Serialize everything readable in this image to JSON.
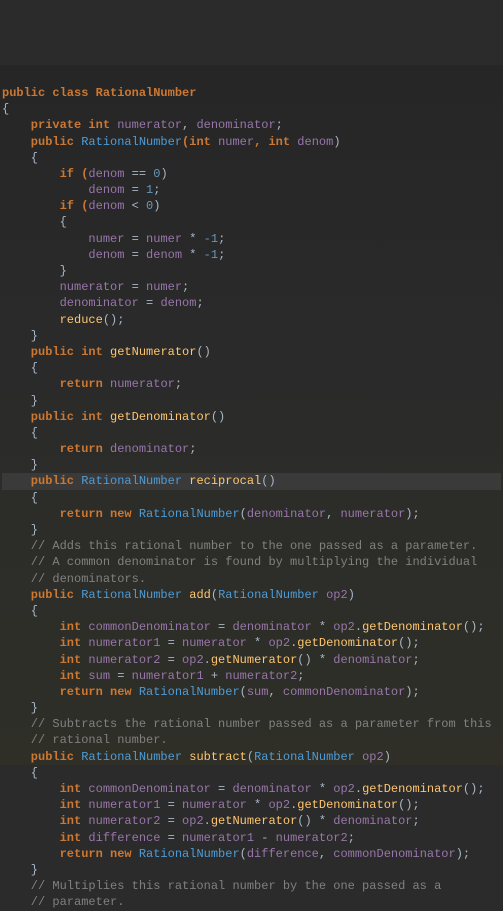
{
  "code": {
    "l00": "public class RationalNumber",
    "l01": "{",
    "l02a": "    private int ",
    "l02b": "numerator",
    "l02c": ", ",
    "l02d": "denominator",
    "l02e": ";",
    "l03a": "    public ",
    "l03b": "RationalNumber",
    "l03c": "(int ",
    "l03d": "numer",
    "l03e": ", int ",
    "l03f": "denom",
    "l03g": ")",
    "l04": "    {",
    "l05a": "        if (",
    "l05b": "denom",
    "l05c": " == ",
    "l05d": "0",
    "l05e": ")",
    "l06a": "            ",
    "l06b": "denom",
    "l06c": " = ",
    "l06d": "1",
    "l06e": ";",
    "l07a": "        if (",
    "l07b": "denom",
    "l07c": " < ",
    "l07d": "0",
    "l07e": ")",
    "l08": "        {",
    "l09a": "            ",
    "l09b": "numer",
    "l09c": " = ",
    "l09d": "numer",
    "l09e": " * ",
    "l09f": "-1",
    "l09g": ";",
    "l10a": "            ",
    "l10b": "denom",
    "l10c": " = ",
    "l10d": "denom",
    "l10e": " * ",
    "l10f": "-1",
    "l10g": ";",
    "l11": "        }",
    "l12a": "        ",
    "l12b": "numerator",
    "l12c": " = ",
    "l12d": "numer",
    "l12e": ";",
    "l13a": "        ",
    "l13b": "denominator",
    "l13c": " = ",
    "l13d": "denom",
    "l13e": ";",
    "l14a": "        ",
    "l14b": "reduce",
    "l14c": "();",
    "l15": "    }",
    "l16a": "    public int ",
    "l16b": "getNumerator",
    "l16c": "()",
    "l17": "    {",
    "l18a": "        return ",
    "l18b": "numerator",
    "l18c": ";",
    "l19": "    }",
    "l20a": "    public int ",
    "l20b": "getDenominator",
    "l20c": "()",
    "l21": "    {",
    "l22a": "        return ",
    "l22b": "denominator",
    "l22c": ";",
    "l23": "    }",
    "l24a": "    public ",
    "l24b": "RationalNumber",
    "l24c": " ",
    "l24d": "reciprocal",
    "l24e": "()",
    "l25": "    {",
    "l26a": "        return new ",
    "l26b": "RationalNumber",
    "l26c": "(",
    "l26d": "denominator",
    "l26e": ", ",
    "l26f": "numerator",
    "l26g": ");",
    "l27": "    }",
    "l28": "    // Adds this rational number to the one passed as a parameter.",
    "l29": "    // A common denominator is found by multiplying the individual",
    "l30": "    // denominators.",
    "l31a": "    public ",
    "l31b": "RationalNumber",
    "l31c": " ",
    "l31d": "add",
    "l31e": "(",
    "l31f": "RationalNumber",
    "l31g": " ",
    "l31h": "op2",
    "l31i": ")",
    "l32": "    {",
    "l33a": "        int ",
    "l33b": "commonDenominator",
    "l33c": " = ",
    "l33d": "denominator",
    "l33e": " * ",
    "l33f": "op2",
    "l33g": ".",
    "l33h": "getDenominator",
    "l33i": "();",
    "l34a": "        int ",
    "l34b": "numerator1",
    "l34c": " = ",
    "l34d": "numerator",
    "l34e": " * ",
    "l34f": "op2",
    "l34g": ".",
    "l34h": "getDenominator",
    "l34i": "();",
    "l35a": "        int ",
    "l35b": "numerator2",
    "l35c": " = ",
    "l35d": "op2",
    "l35e": ".",
    "l35f": "getNumerator",
    "l35g": "() * ",
    "l35h": "denominator",
    "l35i": ";",
    "l36a": "        int ",
    "l36b": "sum",
    "l36c": " = ",
    "l36d": "numerator1",
    "l36e": " + ",
    "l36f": "numerator2",
    "l36g": ";",
    "l37a": "        return new ",
    "l37b": "RationalNumber",
    "l37c": "(",
    "l37d": "sum",
    "l37e": ", ",
    "l37f": "commonDenominator",
    "l37g": ");",
    "l38": "    }",
    "l39": "    // Subtracts the rational number passed as a parameter from this",
    "l40": "    // rational number.",
    "l41a": "    public ",
    "l41b": "RationalNumber",
    "l41c": " ",
    "l41d": "subtract",
    "l41e": "(",
    "l41f": "RationalNumber",
    "l41g": " ",
    "l41h": "op2",
    "l41i": ")",
    "l42": "    {",
    "l43a": "        int ",
    "l43b": "commonDenominator",
    "l43c": " = ",
    "l43d": "denominator",
    "l43e": " * ",
    "l43f": "op2",
    "l43g": ".",
    "l43h": "getDenominator",
    "l43i": "();",
    "l44a": "        int ",
    "l44b": "numerator1",
    "l44c": " = ",
    "l44d": "numerator",
    "l44e": " * ",
    "l44f": "op2",
    "l44g": ".",
    "l44h": "getDenominator",
    "l44i": "();",
    "l45a": "        int ",
    "l45b": "numerator2",
    "l45c": " = ",
    "l45d": "op2",
    "l45e": ".",
    "l45f": "getNumerator",
    "l45g": "() * ",
    "l45h": "denominator",
    "l45i": ";",
    "l46a": "        int ",
    "l46b": "difference",
    "l46c": " = ",
    "l46d": "numerator1",
    "l46e": " - ",
    "l46f": "numerator2",
    "l46g": ";",
    "l47a": "        return new ",
    "l47b": "RationalNumber",
    "l47c": "(",
    "l47d": "difference",
    "l47e": ", ",
    "l47f": "commonDenominator",
    "l47g": ");",
    "l48": "    }",
    "l49": "    // Multiplies this rational number by the one passed as a",
    "l50": "    // parameter."
  }
}
